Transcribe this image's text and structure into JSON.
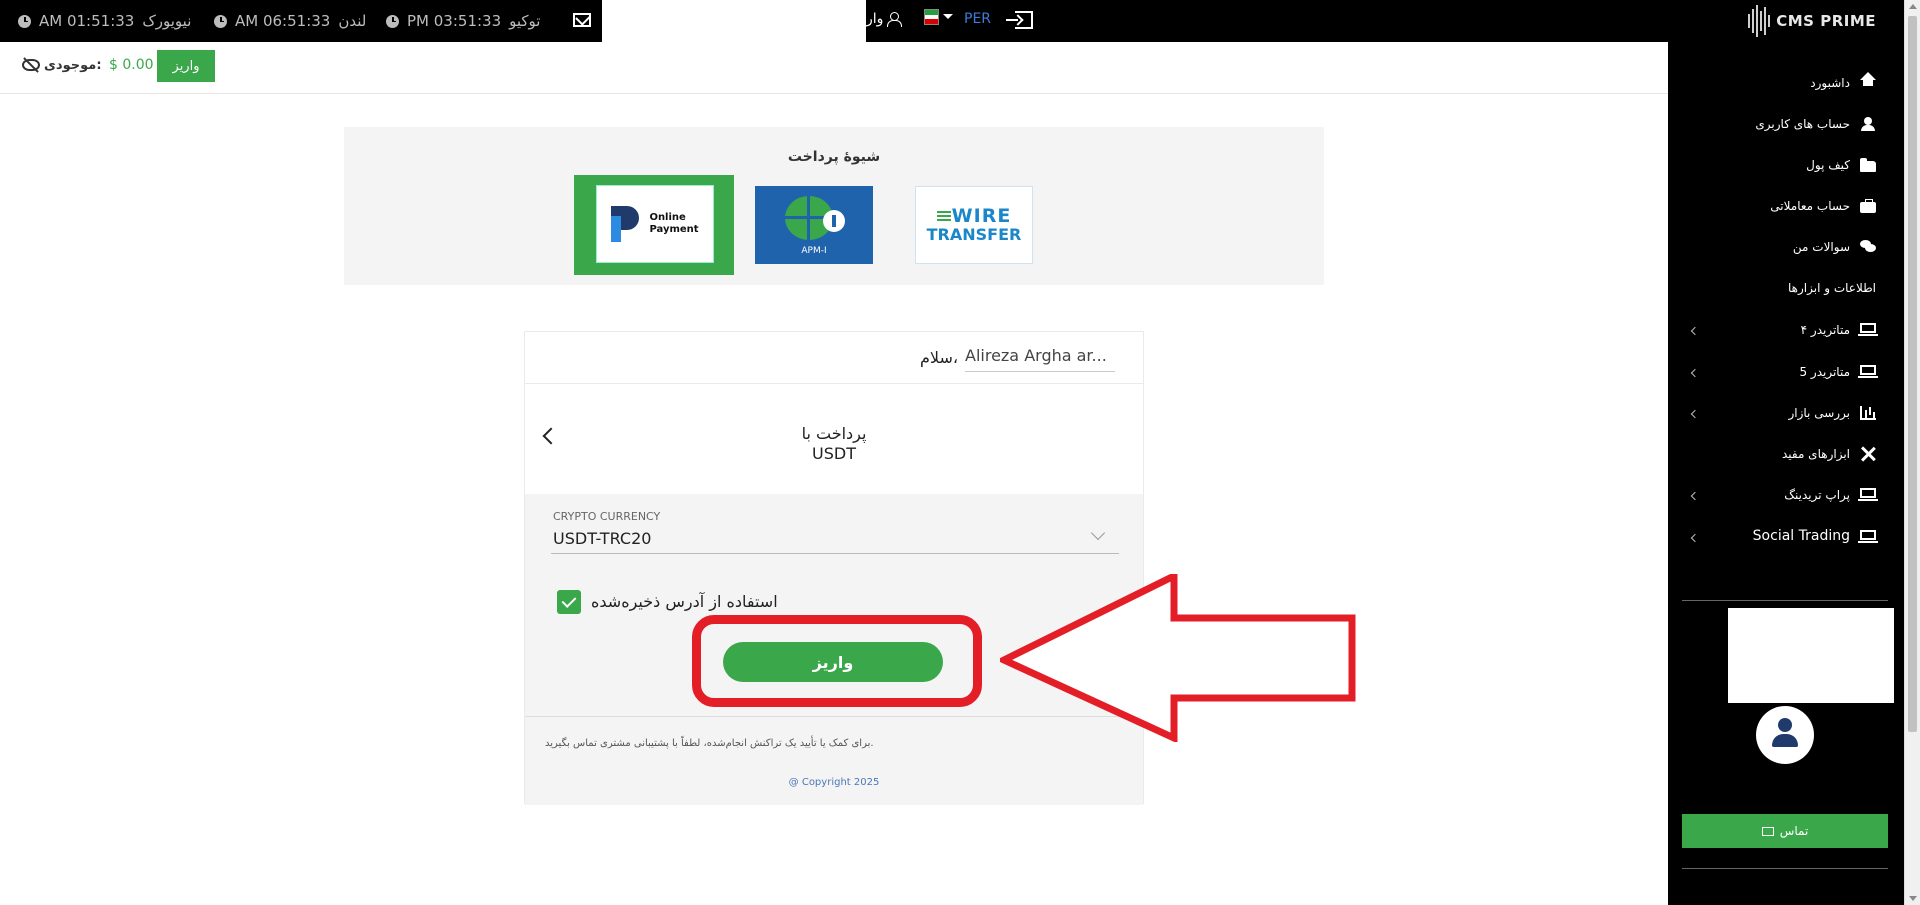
{
  "topbar": {
    "clocks": [
      {
        "city": "نیویورک",
        "time": "AM 01:51:33"
      },
      {
        "city": "لندن",
        "time": "AM 06:51:33"
      },
      {
        "city": "توکیو",
        "time": "PM 03:51:33"
      }
    ],
    "user_label": "وار",
    "language": "PER"
  },
  "balance": {
    "label": "موجودی:",
    "value": "$ 0.00",
    "deposit_label": "واریز"
  },
  "payment_methods": {
    "title": "شیوهٔ پرداخت",
    "online": {
      "line1": "Online",
      "line2": "Payment"
    },
    "apm": {
      "label": "APM-I"
    },
    "wire": {
      "line1": "WIRE",
      "line2": "TRANSFER"
    }
  },
  "card": {
    "user_name": "Alireza Argha ar...",
    "greeting": "سلام،",
    "pay_with": "پرداخت با",
    "method": "USDT",
    "currency_label": "CRYPTO CURRENCY",
    "currency_value": "USDT-TRC20",
    "saved_address_label": "استفاده از آدرس ذخیره‌شده",
    "deposit_label": "واریز",
    "support_text": "برای کمک یا تأیید یک تراکنش انجام‌شده، لطفاً با پشتیبانی مشتری تماس بگیرید.",
    "copyright": "@ Copyright 2025"
  },
  "sidebar": {
    "brand": "CMS PRIME",
    "items": [
      {
        "label": "داشبورد"
      },
      {
        "label": "حساب های کاربری"
      },
      {
        "label": "کیف پول"
      },
      {
        "label": "حساب معاملاتی"
      },
      {
        "label": "سوالات من"
      },
      {
        "label": "اطلاعات و ابزارها"
      },
      {
        "label": "متاتریدر ۴"
      },
      {
        "label": "متاتریدر 5"
      },
      {
        "label": "بررسی بازار"
      },
      {
        "label": "ابزارهای مفید"
      },
      {
        "label": "پراپ تریدینگ"
      },
      {
        "label": "Social Trading"
      }
    ],
    "contact_label": "تماس"
  },
  "colors": {
    "accent_green": "#3aa84a",
    "annotation_red": "#e41e26",
    "link_blue": "#3d7bd8"
  }
}
